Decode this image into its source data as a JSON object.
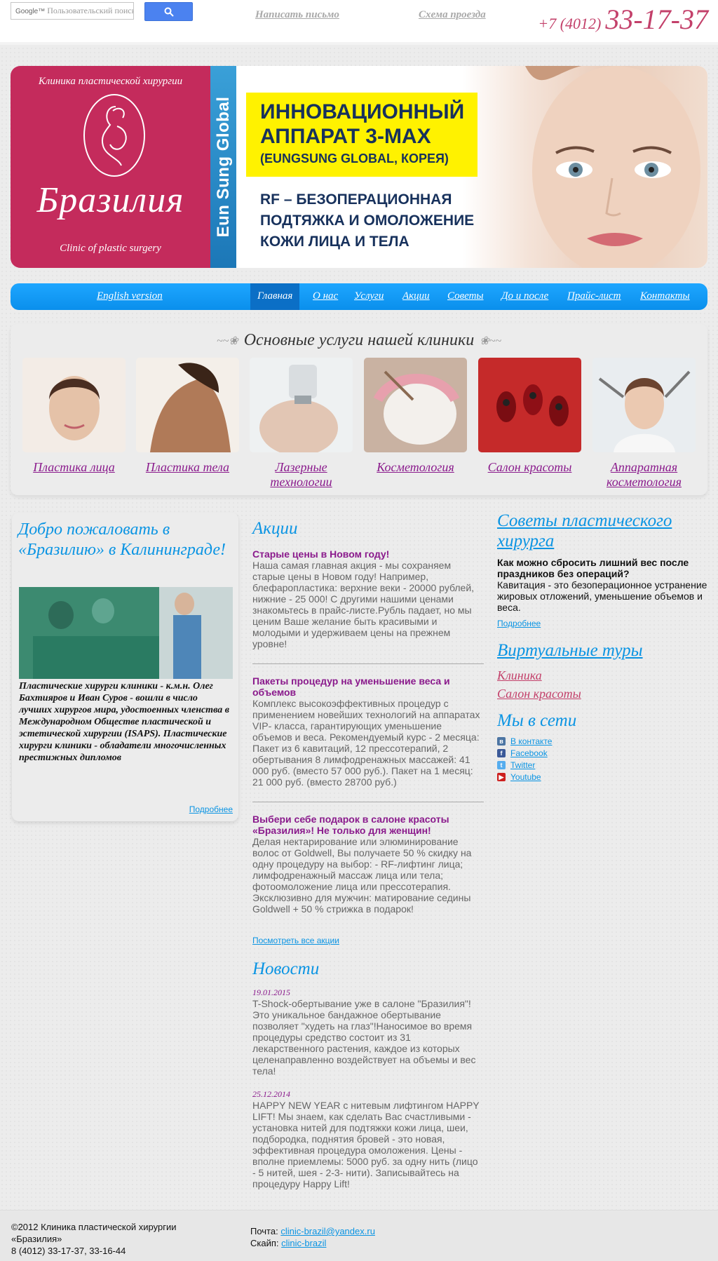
{
  "search": {
    "brand": "Google™",
    "placeholder": "Пользовательский поиск",
    "icon": "search-icon"
  },
  "header": {
    "write_link": "Написать письмо",
    "route_link": "Схема проезда",
    "phone_code": "+7 (4012)",
    "phone_number": "33-17-37"
  },
  "banner": {
    "logo_top": "Клиника пластической хирургии",
    "logo_name": "Бразилия",
    "logo_sub": "Clinic of plastic surgery",
    "vertical_brand": "Eun Sung Global",
    "ad_title_1": "ИННОВАЦИОННЫЙ",
    "ad_title_2": "АППАРАТ 3-MAX",
    "ad_title_3": "(EUNGSUNG GLOBAL, КОРЕЯ)",
    "ad_sub_1": "RF – БЕЗОПЕРАЦИОННАЯ",
    "ad_sub_2": "ПОДТЯЖКА И ОМОЛОЖЕНИЕ",
    "ad_sub_3": "КОЖИ ЛИЦА И ТЕЛА"
  },
  "nav": {
    "english": "English version",
    "items": [
      "Главная",
      "О нас",
      "Услуги",
      "Акции",
      "Советы",
      "До и после",
      "Прайс-лист",
      "Контакты"
    ],
    "active_index": 0
  },
  "services": {
    "title": "Основные услуги нашей клиники",
    "items": [
      {
        "label": "Пластика лица"
      },
      {
        "label": "Пластика тела"
      },
      {
        "label": "Лазерные технологии"
      },
      {
        "label": "Косметология"
      },
      {
        "label": "Салон красоты"
      },
      {
        "label": "Аппаратная косметология"
      }
    ]
  },
  "welcome": {
    "title": "Добро пожаловать в «Бразилию» в Калининграде!",
    "text": "Пластические хирурги клиники - к.м.н. Олег Бахтияров и Иван Суров - вошли в число лучших хирургов мира, удостоенных членства в Международном Обществе пластической и эстетической хирургии (ISAPS). Пластические хирурги клиники - обладатели многочисленных престижных дипломов",
    "more": "Подробнее"
  },
  "promos": {
    "title": "Акции",
    "items": [
      {
        "title": "Старые цены в Новом году!",
        "text": "Наша самая главная акция - мы сохраняем старые цены в Новом году! Например, блефаропластика: верхние веки - 20000 рублей, нижние - 25 000! С другими нашими ценами знакомьтесь в прайс-листе.Рубль падает, но мы ценим Ваше желание быть красивыми и молодыми и удерживаем цены на прежнем уровне!"
      },
      {
        "title": "Пакеты процедур на уменьшение веса и объемов",
        "text": "Комплекс высокоэффективных процедур с применением новейших технологий на аппаратах VIP- класса, гарантирующих уменьшение объемов и веса. Рекомендуемый курс - 2 месяца: Пакет из 6 кавитаций, 12 прессотерапий, 2 обертывания 8 лимфодренажных массажей: 41 000 руб. (вместо 57 000 руб.). Пакет на 1 месяц: 21 000 руб. (вместо 28700 руб.)"
      },
      {
        "title": "Выбери себе подарок в салоне красоты «Бразилия»! Не только для женщин!",
        "text": "Делая нектарирование или элюминирование волос от Goldwell, Вы получаете 50 % скидку на одну процедуру на выбор: - RF-лифтинг лица; лимфодренажный массаж лица или тела; фотоомоложение лица или прессотерапия. Эксклюзивно для мужчин: матирование седины Goldwell + 50 % стрижка в подарок!"
      }
    ],
    "all_link": "Посмотреть все акции"
  },
  "news": {
    "title": "Новости",
    "items": [
      {
        "date": "19.01.2015",
        "text": "T-Shock-обертывание уже в салоне \"Бразилия\"!Это уникальное бандажное обертывание позволяет \"худеть на глаз\"!Наносимое во время процедуры средство состоит из 31 лекарственного растения, каждое из которых целенаправленно воздействует на объемы и вес тела!"
      },
      {
        "date": "25.12.2014",
        "text": "HAPPY NEW YEAR с нитевым лифтингом HAPPY LIFT! Мы знаем, как сделать Вас счастливыми - установка нитей для подтяжки кожи лица, шеи, подбородка, поднятия бровей - это новая, эффективная процедура омоложения. Цены - вполне приемлемы: 5000 руб. за одну нить (лицо - 5 нитей, шея - 2-3- нити). Записывайтесь на процедуру Happy Lift!"
      }
    ]
  },
  "tips": {
    "title": "Советы пластического хирурга",
    "question": "Как можно сбросить лишний вес после праздников без операций?",
    "answer": "Кавитация - это безоперационное устранение жировых отложений, уменьшение объемов и веса.",
    "more": "Подробнее"
  },
  "tours": {
    "title": "Виртуальные туры",
    "items": [
      "Клиника",
      "Салон красоты"
    ]
  },
  "social": {
    "title": "Мы в сети",
    "items": [
      {
        "label": "В контакте",
        "icon": "vk-icon",
        "color": "#4c75a3"
      },
      {
        "label": "Facebook",
        "icon": "facebook-icon",
        "color": "#3b5998"
      },
      {
        "label": "Twitter",
        "icon": "twitter-icon",
        "color": "#55acee"
      },
      {
        "label": "Youtube",
        "icon": "youtube-icon",
        "color": "#cd201f"
      }
    ]
  },
  "footer": {
    "copyright_1": "©2012 Клиника пластической хирургии",
    "copyright_2": "«Бразилия»",
    "phones": "8 (4012) 33-17-37, 33-16-44",
    "mail_label": "Почта:",
    "mail": "clinic-brazil@yandex.ru",
    "skype_label": "Скайп:",
    "skype": "clinic-brazil"
  },
  "colors": {
    "accent_blue": "#0a94e3",
    "brand_pink": "#c3406a",
    "purple": "#8a1a8c",
    "nav_blue": "#0a8fec"
  }
}
